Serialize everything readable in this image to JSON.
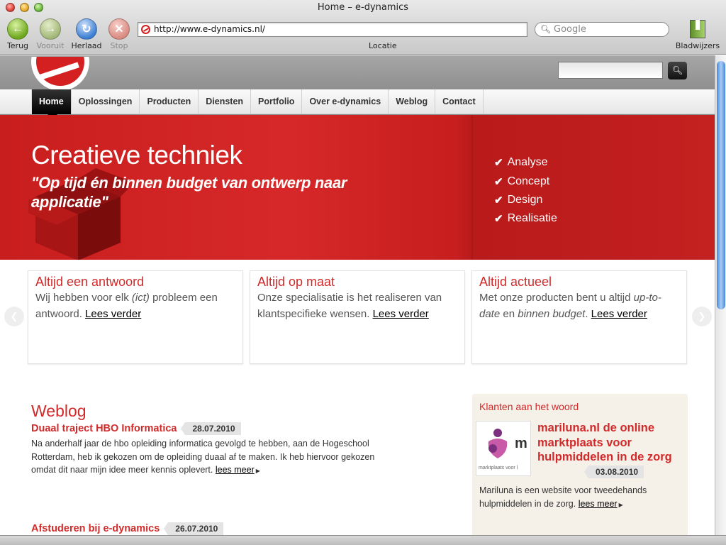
{
  "window": {
    "title": "Home – e-dynamics"
  },
  "toolbar": {
    "back_label": "Terug",
    "forward_label": "Vooruit",
    "reload_label": "Herlaad",
    "stop_label": "Stop",
    "url": "http://www.e-dynamics.nl/",
    "url_label": "Locatie",
    "search_placeholder": "Google",
    "bookmarks_label": "Bladwijzers"
  },
  "nav": {
    "items": [
      {
        "label": "Home",
        "active": true
      },
      {
        "label": "Oplossingen"
      },
      {
        "label": "Producten"
      },
      {
        "label": "Diensten"
      },
      {
        "label": "Portfolio"
      },
      {
        "label": "Over e-dynamics"
      },
      {
        "label": "Weblog"
      },
      {
        "label": "Contact"
      }
    ]
  },
  "hero": {
    "title": "Creatieve techniek",
    "subtitle": "\"Op tijd én binnen budget van ontwerp naar applicatie\"",
    "list": [
      "Analyse",
      "Concept",
      "Design",
      "Realisatie"
    ]
  },
  "cards": [
    {
      "title": "Altijd een antwoord",
      "text_before": "Wij hebben voor elk ",
      "text_em": "(ict)",
      "text_after": " probleem een antwoord. ",
      "link": "Lees verder"
    },
    {
      "title": "Altijd op maat",
      "text": "Onze specialisatie is het realiseren van klantspecifieke wensen. ",
      "link": "Lees verder"
    },
    {
      "title": "Altijd actueel",
      "text_before": "Met onze producten bent u altijd ",
      "text_em1": "up-to-date",
      "text_mid": " en ",
      "text_em2": "binnen budget",
      "text_after": ". ",
      "link": "Lees verder"
    }
  ],
  "weblog": {
    "title": "Weblog",
    "posts": [
      {
        "title": "Duaal traject HBO Informatica",
        "date": "28.07.2010",
        "text": "Na anderhalf jaar de hbo opleiding informatica gevolgd te hebben, aan de Hogeschool Rotterdam, heb ik gekozen om de opleiding duaal af te maken. Ik heb hiervoor gekozen omdat dit naar mijn idee meer kennis oplevert. ",
        "more": "lees meer"
      },
      {
        "title": "Afstuderen bij e-dynamics",
        "date": "26.07.2010"
      }
    ]
  },
  "testimonials": {
    "title": "Klanten aan het woord",
    "logo_letter": "m",
    "logo_text": "marktplaats voor l",
    "headline": "mariluna.nl de online marktplaats voor hulpmiddelen in de zorg",
    "date": "03.08.2010",
    "text": "Mariluna is een website voor tweedehands hulpmiddelen in de zorg. ",
    "more": "lees meer"
  },
  "colors": {
    "brand_red": "#d12a2a",
    "hero_red": "#c91e1e"
  }
}
